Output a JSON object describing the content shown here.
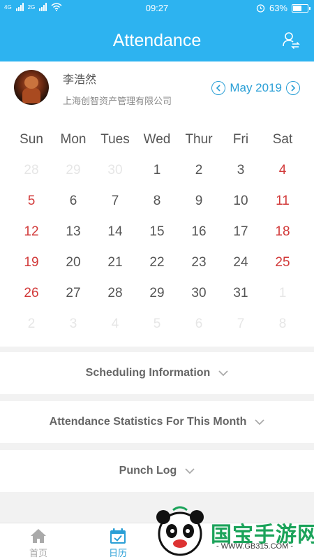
{
  "status_bar": {
    "network_left": "4G",
    "network_right": "2G",
    "time": "09:27",
    "battery": "63%",
    "battery_level": 0.63
  },
  "header": {
    "title": "Attendance",
    "user_switch_icon": "user-switch-icon"
  },
  "profile": {
    "name": "李浩然",
    "company": "上海创智资产管理有限公司",
    "month": "May 2019",
    "prev_icon": "chevron-left-icon",
    "next_icon": "chevron-right-icon"
  },
  "calendar": {
    "weekdays": [
      "Sun",
      "Mon",
      "Tues",
      "Wed",
      "Thur",
      "Fri",
      "Sat"
    ],
    "weeks": [
      [
        {
          "d": "28",
          "s": "faded"
        },
        {
          "d": "29",
          "s": "faded"
        },
        {
          "d": "30",
          "s": "faded"
        },
        {
          "d": "1",
          "s": "normal"
        },
        {
          "d": "2",
          "s": "normal"
        },
        {
          "d": "3",
          "s": "normal"
        },
        {
          "d": "4",
          "s": "weekend"
        }
      ],
      [
        {
          "d": "5",
          "s": "weekend"
        },
        {
          "d": "6",
          "s": "normal"
        },
        {
          "d": "7",
          "s": "normal"
        },
        {
          "d": "8",
          "s": "normal"
        },
        {
          "d": "9",
          "s": "normal"
        },
        {
          "d": "10",
          "s": "normal"
        },
        {
          "d": "11",
          "s": "weekend"
        }
      ],
      [
        {
          "d": "12",
          "s": "weekend"
        },
        {
          "d": "13",
          "s": "normal"
        },
        {
          "d": "14",
          "s": "normal"
        },
        {
          "d": "15",
          "s": "normal"
        },
        {
          "d": "16",
          "s": "normal"
        },
        {
          "d": "17",
          "s": "normal"
        },
        {
          "d": "18",
          "s": "weekend"
        }
      ],
      [
        {
          "d": "19",
          "s": "weekend"
        },
        {
          "d": "20",
          "s": "normal"
        },
        {
          "d": "21",
          "s": "normal"
        },
        {
          "d": "22",
          "s": "normal"
        },
        {
          "d": "23",
          "s": "normal"
        },
        {
          "d": "24",
          "s": "normal"
        },
        {
          "d": "25",
          "s": "weekend"
        }
      ],
      [
        {
          "d": "26",
          "s": "weekend"
        },
        {
          "d": "27",
          "s": "normal"
        },
        {
          "d": "28",
          "s": "normal"
        },
        {
          "d": "29",
          "s": "normal"
        },
        {
          "d": "30",
          "s": "normal"
        },
        {
          "d": "31",
          "s": "normal"
        },
        {
          "d": "1",
          "s": "faded"
        }
      ],
      [
        {
          "d": "2",
          "s": "faded"
        },
        {
          "d": "3",
          "s": "faded"
        },
        {
          "d": "4",
          "s": "faded"
        },
        {
          "d": "5",
          "s": "faded"
        },
        {
          "d": "6",
          "s": "faded"
        },
        {
          "d": "7",
          "s": "faded"
        },
        {
          "d": "8",
          "s": "faded"
        }
      ]
    ]
  },
  "sections": {
    "scheduling": "Scheduling Information",
    "statistics": "Attendance Statistics For This Month",
    "punch_log": "Punch Log"
  },
  "tabbar": {
    "home_label": "首页",
    "calendar_label": "日历"
  },
  "watermark": {
    "text": "国宝手游网",
    "url": "- WWW.GB315.COM -"
  },
  "colors": {
    "header_blue": "#2db3f0",
    "accent_blue": "#2a9fd6",
    "weekend_red": "#d23a3a",
    "faded_gray": "#e6e6e6"
  }
}
